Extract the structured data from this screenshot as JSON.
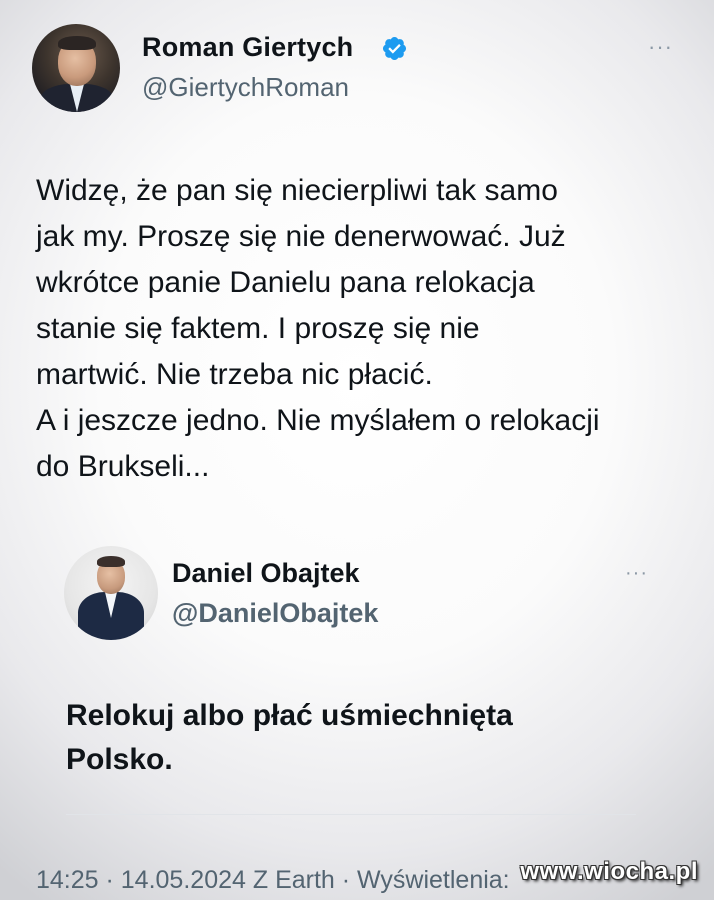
{
  "main_tweet": {
    "author_name": "Roman Giertych",
    "handle": "@GiertychRoman",
    "more_icon": "more-icon",
    "text": "Widzę, że pan się niecierpliwi tak samo\njak my. Proszę się nie denerwować. Już\nwkrótce panie Danielu pana relokacja\nstanie się faktem. I proszę się nie\nmartwić. Nie trzeba nic płacić.\nA i jeszcze jedno. Nie myślałem o relokacji\ndo Brukseli...",
    "meta": "14:25 · 14.05.2024 Z Earth · Wyświetlenia:"
  },
  "quoted_tweet": {
    "author_name": "Daniel Obajtek",
    "handle": "@DanielObajtek",
    "more_icon": "more-icon",
    "text": "Relokuj albo płać uśmiechnięta Polsko."
  },
  "watermark": "www.wiocha.pl",
  "colors": {
    "verified_badge": "#1d9bf0",
    "text_primary": "#0f1419",
    "text_secondary": "#536471"
  }
}
